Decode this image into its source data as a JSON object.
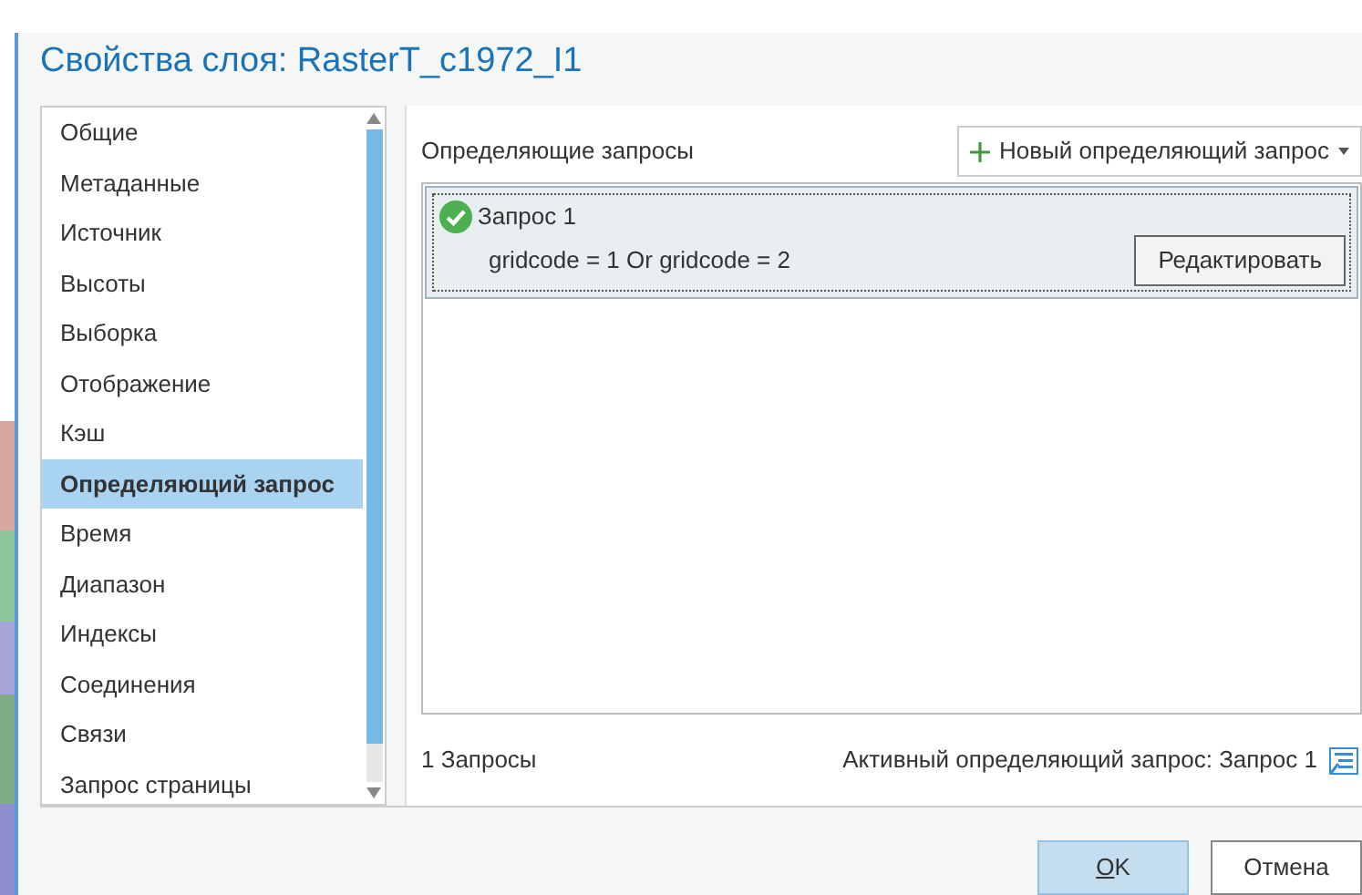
{
  "window": {
    "title": "Свойства слоя: RasterT_c1972_I1"
  },
  "sidebar": {
    "items": [
      {
        "label": "Общие",
        "selected": false
      },
      {
        "label": "Метаданные",
        "selected": false
      },
      {
        "label": "Источник",
        "selected": false
      },
      {
        "label": "Высоты",
        "selected": false
      },
      {
        "label": "Выборка",
        "selected": false
      },
      {
        "label": "Отображение",
        "selected": false
      },
      {
        "label": "Кэш",
        "selected": false
      },
      {
        "label": "Определяющий запрос",
        "selected": true
      },
      {
        "label": "Время",
        "selected": false
      },
      {
        "label": "Диапазон",
        "selected": false
      },
      {
        "label": "Индексы",
        "selected": false
      },
      {
        "label": "Соединения",
        "selected": false
      },
      {
        "label": "Связи",
        "selected": false
      },
      {
        "label": "Запрос страницы",
        "selected": false
      }
    ]
  },
  "panel": {
    "heading": "Определяющие запросы",
    "new_button": "Новый определяющий запрос",
    "queries": [
      {
        "name": "Запрос 1",
        "expression": "gridcode = 1 Or gridcode = 2",
        "active": true,
        "selected": true,
        "edit_button": "Редактировать"
      }
    ],
    "count": "1 Запросы",
    "active_query": "Активный определяющий запрос: Запрос 1"
  },
  "buttons": [
    {
      "label": "OK",
      "accel_first": true,
      "default": true
    },
    {
      "label": "Отмена",
      "default": false
    }
  ]
}
